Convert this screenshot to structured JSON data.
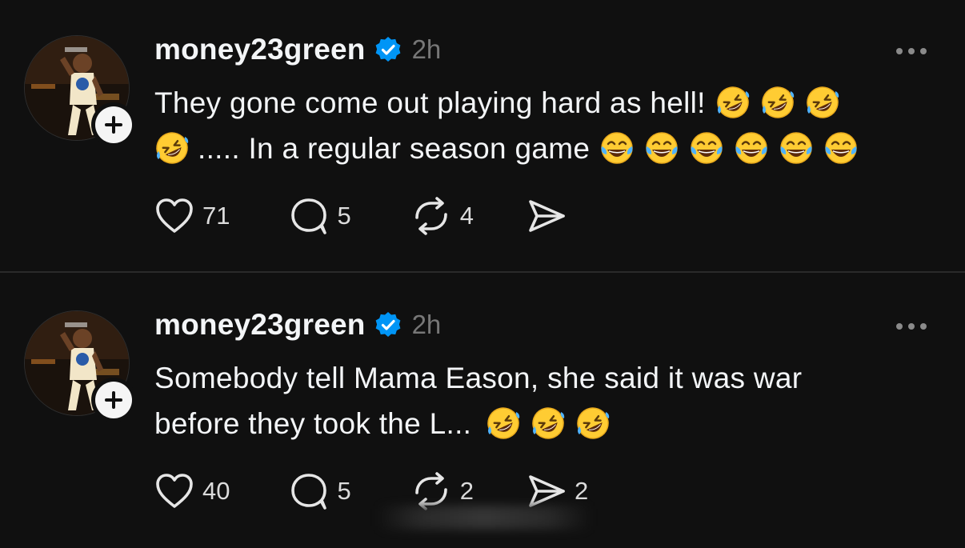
{
  "colors": {
    "background": "#101010",
    "text": "#f3f5f7",
    "muted": "#777777",
    "verified": "#0095f6",
    "divider": "#2a2a2a"
  },
  "posts": [
    {
      "username": "money23green",
      "time": "2h",
      "text_lines": [
        "They gone come out playing hard as hell!",
        "..... In a regular season game"
      ],
      "emojis": {
        "line1": [
          "rofl-emoji",
          "rofl-emoji",
          "rofl-emoji"
        ],
        "line2_lead": [
          "rofl-emoji"
        ],
        "line2_trail": [
          "joy-emoji",
          "joy-emoji",
          "joy-emoji",
          "joy-emoji",
          "joy-emoji",
          "joy-emoji"
        ]
      },
      "actions": {
        "likes": "71",
        "replies": "5",
        "reposts": "4",
        "shares": ""
      }
    },
    {
      "username": "money23green",
      "time": "2h",
      "text_lines": [
        "Somebody tell Mama Eason, she said it was war",
        "before they took the L..."
      ],
      "emojis": {
        "line2_trail": [
          "rofl-emoji",
          "rofl-emoji",
          "rofl-emoji"
        ]
      },
      "actions": {
        "likes": "40",
        "replies": "5",
        "reposts": "2",
        "shares": "2"
      }
    }
  ]
}
